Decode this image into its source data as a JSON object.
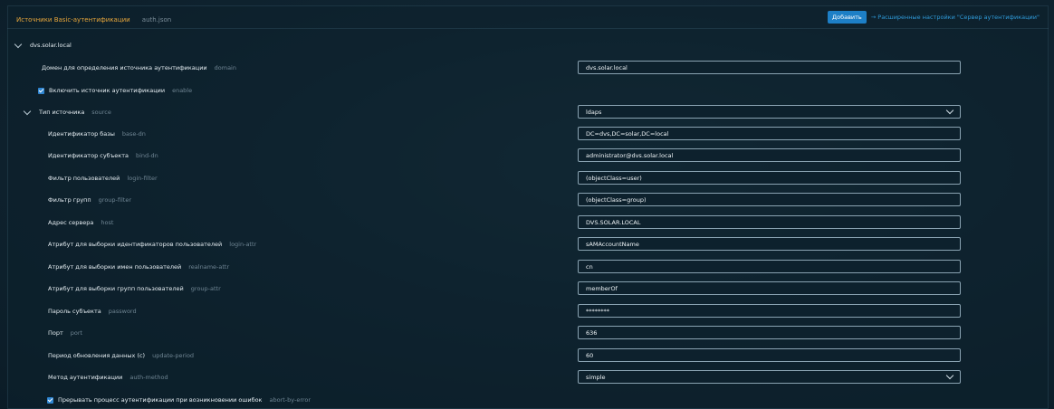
{
  "header": {
    "title": "Источники Basic-аутентификации",
    "file": "auth.json",
    "add_label": "Добавить",
    "advanced_link": "→ Расширенные настройки \"Сервер аутентификации\""
  },
  "source": {
    "name": "dvs.solar.local",
    "domain": {
      "label": "Домен для определения источника аутентификации",
      "key": "domain",
      "value": "dvs.solar.local"
    },
    "enable": {
      "label": "Включить источник аутентификации",
      "key": "enable",
      "checked": true
    },
    "type": {
      "label": "Тип источника",
      "key": "source",
      "value": "ldaps"
    },
    "fields": [
      {
        "label": "Идентификатор базы",
        "key": "base-dn",
        "value": "DC=dvs,DC=solar,DC=local"
      },
      {
        "label": "Идентификатор субъекта",
        "key": "bind-dn",
        "value": "administrator@dvs.solar.local"
      },
      {
        "label": "Фильтр пользователей",
        "key": "login-filter",
        "value": "(objectClass=user)"
      },
      {
        "label": "Фильтр групп",
        "key": "group-filter",
        "value": "(objectClass=group)"
      },
      {
        "label": "Адрес сервера",
        "key": "host",
        "value": "DVS.SOLAR.LOCAL"
      },
      {
        "label": "Атрибут для выборки идентификаторов пользователей",
        "key": "login-attr",
        "value": "sAMAccountName"
      },
      {
        "label": "Атрибут для выборки имен пользователей",
        "key": "realname-attr",
        "value": "cn"
      },
      {
        "label": "Атрибут для выборки групп пользователей",
        "key": "group-attr",
        "value": "memberOf"
      },
      {
        "label": "Пароль субъекта",
        "key": "password",
        "value": "********"
      },
      {
        "label": "Порт",
        "key": "port",
        "value": "636"
      },
      {
        "label": "Период обновления данных (с)",
        "key": "update-period",
        "value": "60"
      },
      {
        "label": "Метод аутентификации",
        "key": "auth-method",
        "value": "simple"
      }
    ],
    "abort": {
      "label": "Прерывать процесс аутентификации при возникновении ошибок",
      "key": "abort-by-error",
      "checked": true
    }
  }
}
